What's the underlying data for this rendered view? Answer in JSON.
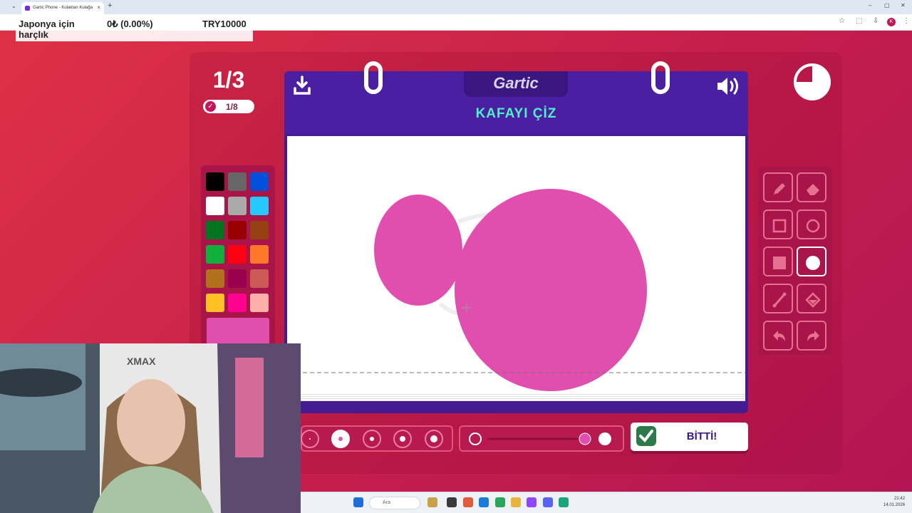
{
  "browser": {
    "tab_title": "Gartic Phone - Kulaktan Kulağa",
    "new_tab": "+",
    "tab_close": "×",
    "tab_menu": "⌄",
    "window_minimize": "–",
    "window_restore": "▢",
    "window_close": "✕",
    "profile_initial": "K"
  },
  "ticker": {
    "item1": "Japonya için harçlık",
    "item2": "0₺ (0.00%)",
    "item3": "TRY10000"
  },
  "game": {
    "logo": "Gartic",
    "prompt": "KAFAYI ÇİZ",
    "round": "1/3",
    "players_done": "1/8",
    "timer_remaining_fraction": 0.75,
    "done_button": "BİTTİ!",
    "current_color": "#e04fad",
    "palette": [
      "#000000",
      "#666666",
      "#0050dc",
      "#ffffff",
      "#aaaaaa",
      "#26c9ff",
      "#017420",
      "#990000",
      "#964112",
      "#11b03c",
      "#ff0013",
      "#ff7829",
      "#b0701c",
      "#99004e",
      "#cb5a57",
      "#ffc126",
      "#ff008f",
      "#feafa8"
    ],
    "selected_tool": "filled-ellipse",
    "brush_size_selected_index": 1,
    "opacity_fraction": 0.88
  },
  "taskbar": {
    "search_placeholder": "Ara",
    "time": "21:42",
    "date": "14.01.2026"
  }
}
